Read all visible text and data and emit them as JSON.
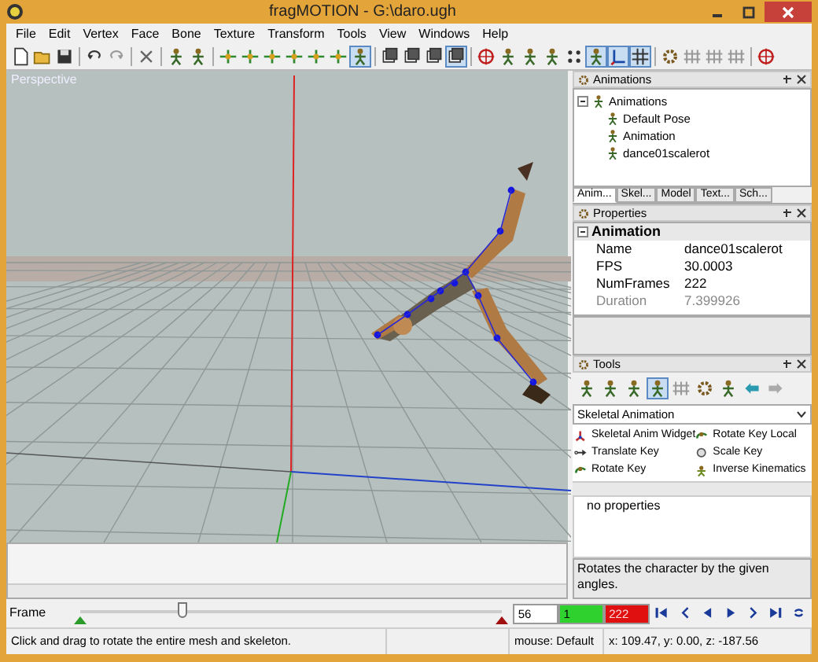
{
  "window": {
    "title": "fragMOTION - G:\\daro.ugh"
  },
  "menu": [
    "File",
    "Edit",
    "Vertex",
    "Face",
    "Bone",
    "Texture",
    "Transform",
    "Tools",
    "View",
    "Windows",
    "Help"
  ],
  "toolbar": [
    [
      {
        "kind": "new",
        "selected": false
      },
      {
        "kind": "open",
        "selected": false
      },
      {
        "kind": "save",
        "selected": false
      }
    ],
    [
      {
        "kind": "undo",
        "selected": false
      },
      {
        "kind": "redo",
        "selected": false
      }
    ],
    [
      {
        "kind": "delete",
        "selected": false
      }
    ],
    [
      {
        "kind": "figure",
        "selected": false
      },
      {
        "kind": "figure",
        "selected": false
      }
    ],
    [
      {
        "kind": "move",
        "selected": false
      },
      {
        "kind": "move",
        "selected": false
      },
      {
        "kind": "move",
        "selected": false
      },
      {
        "kind": "move",
        "selected": false
      },
      {
        "kind": "move",
        "selected": false
      },
      {
        "kind": "move",
        "selected": false
      },
      {
        "kind": "figure",
        "selected": true
      }
    ],
    [
      {
        "kind": "view",
        "selected": false
      },
      {
        "kind": "view",
        "selected": false
      },
      {
        "kind": "view",
        "selected": false
      },
      {
        "kind": "view",
        "selected": true
      }
    ],
    [
      {
        "kind": "target",
        "selected": false
      },
      {
        "kind": "figure",
        "selected": false
      },
      {
        "kind": "figure",
        "selected": false
      },
      {
        "kind": "figure",
        "selected": false
      },
      {
        "kind": "dots",
        "selected": false
      },
      {
        "kind": "figure",
        "selected": true
      },
      {
        "kind": "axes",
        "selected": true
      },
      {
        "kind": "grid",
        "selected": true
      }
    ],
    [
      {
        "kind": "gear",
        "selected": false
      },
      {
        "kind": "bars",
        "selected": false
      },
      {
        "kind": "bars",
        "selected": false
      },
      {
        "kind": "bars",
        "selected": false
      }
    ],
    [
      {
        "kind": "target",
        "selected": false
      }
    ]
  ],
  "viewport": {
    "label": "Perspective"
  },
  "animations_panel": {
    "title": "Animations",
    "tree": [
      {
        "label": "Animations",
        "expanded": true,
        "children": [
          {
            "label": "Default Pose"
          },
          {
            "label": "Animation"
          },
          {
            "label": "dance01scalerot"
          }
        ]
      }
    ],
    "tabs": [
      {
        "label": "Anim...",
        "selected": true
      },
      {
        "label": "Skel...",
        "selected": false
      },
      {
        "label": "Model",
        "selected": false
      },
      {
        "label": "Text...",
        "selected": false
      },
      {
        "label": "Sch...",
        "selected": false
      }
    ]
  },
  "properties_panel": {
    "title": "Properties",
    "group": {
      "label": "Animation",
      "expanded": true
    },
    "rows": [
      {
        "name": "Name",
        "value": "dance01scalerot",
        "disabled": false
      },
      {
        "name": "FPS",
        "value": "30.0003",
        "disabled": false
      },
      {
        "name": "NumFrames",
        "value": "222",
        "disabled": false
      },
      {
        "name": "Duration",
        "value": "7.399926",
        "disabled": true
      }
    ]
  },
  "tools_panel": {
    "title": "Tools",
    "tool_buttons": [
      {
        "kind": "figure",
        "selected": false
      },
      {
        "kind": "figure",
        "selected": false
      },
      {
        "kind": "figure",
        "selected": false
      },
      {
        "kind": "figure",
        "selected": true
      },
      {
        "kind": "bars",
        "selected": false
      },
      {
        "kind": "gear",
        "selected": false
      },
      {
        "kind": "figure",
        "selected": false
      },
      {
        "kind": "back",
        "selected": false
      },
      {
        "kind": "forward",
        "selected": false
      }
    ],
    "dropdown": {
      "value": "Skeletal Animation"
    },
    "tools": [
      {
        "label": "Skeletal Anim Widget",
        "kind": "widget"
      },
      {
        "label": "Rotate Key Local",
        "kind": "rotate"
      },
      {
        "label": "Translate Key",
        "kind": "translate"
      },
      {
        "label": "Scale Key",
        "kind": "scale"
      },
      {
        "label": "Rotate Key",
        "kind": "rotate"
      },
      {
        "label": "Inverse Kinematics",
        "kind": "ik"
      }
    ],
    "properties_text": "no properties",
    "description": "Rotates the character by the given angles."
  },
  "timeline": {
    "label": "Frame",
    "level": 0.25,
    "current_frame": "56",
    "start_frame": "1",
    "end_frame": "222",
    "buttons": [
      {
        "kind": "first"
      },
      {
        "kind": "prev-key"
      },
      {
        "kind": "prev"
      },
      {
        "kind": "play"
      },
      {
        "kind": "next-key"
      },
      {
        "kind": "last"
      },
      {
        "kind": "loop"
      }
    ]
  },
  "status_bar": {
    "message": "Click and drag to rotate the entire mesh and skeleton.",
    "mouse": "mouse: Default",
    "coords": "x: 109.47, y: 0.00, z: -187.56"
  }
}
